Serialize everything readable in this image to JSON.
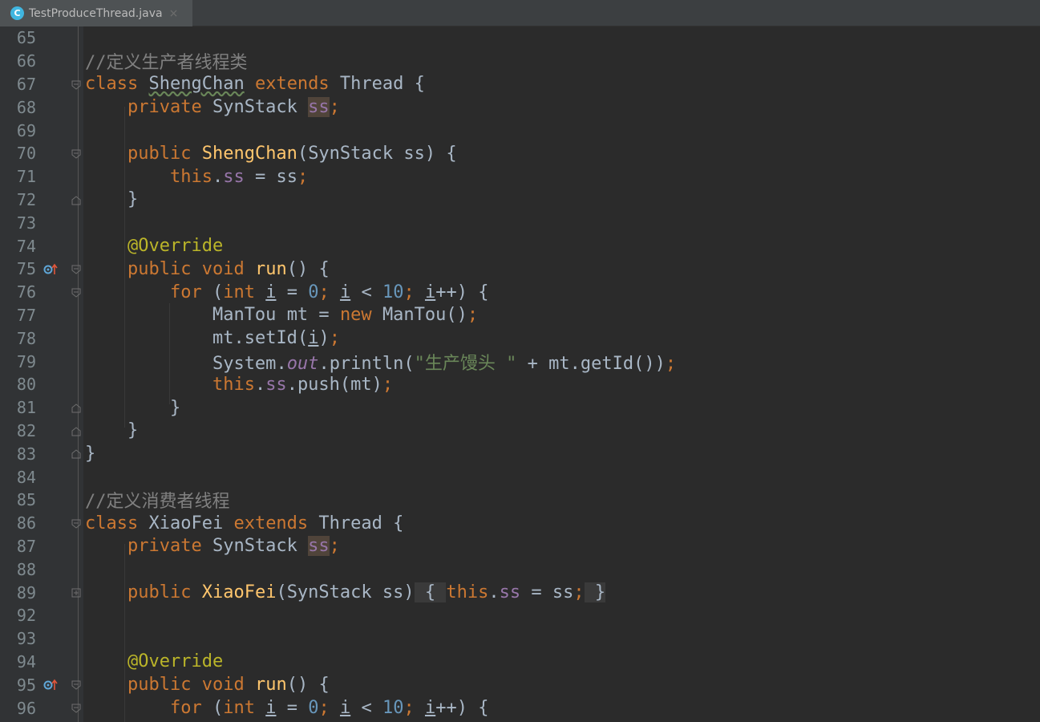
{
  "tab": {
    "icon": "C",
    "title": "TestProduceThread.java",
    "close": "×"
  },
  "lines": {
    "65": "65",
    "66": "66",
    "67": "67",
    "68": "68",
    "69": "69",
    "70": "70",
    "71": "71",
    "72": "72",
    "73": "73",
    "74": "74",
    "75": "75",
    "76": "76",
    "77": "77",
    "78": "78",
    "79": "79",
    "80": "80",
    "81": "81",
    "82": "82",
    "83": "83",
    "84": "84",
    "85": "85",
    "86": "86",
    "87": "87",
    "88": "88",
    "89": "89",
    "92": "92",
    "93": "93",
    "94": "94",
    "95": "95",
    "96": "96"
  },
  "code": {
    "c66": "//定义生产者线程类",
    "c85": "//定义消费者线程",
    "kw_class": "class",
    "kw_extends": "extends",
    "kw_private": "private",
    "kw_public": "public",
    "kw_void": "void",
    "kw_this": "this",
    "kw_for": "for",
    "kw_int": "int",
    "kw_new": "new",
    "t_thread": "Thread",
    "t_synstack": "SynStack",
    "t_mantou": "ManTou",
    "t_system": "System",
    "cls_sheng": "ShengChan",
    "cls_xiao": "XiaoFei",
    "f_ss": "ss",
    "f_out": "out",
    "v_i": "i",
    "v_mt": "mt",
    "n_0": "0",
    "n_10": "10",
    "an_override": "@Override",
    "m_run": "run",
    "m_setid": "setId",
    "m_println": "println",
    "m_getid": "getId",
    "m_push": "push",
    "str_sc": "\"生产馒头 \""
  },
  "colors": {
    "background": "#2b2b2b",
    "keyword": "#cc7832",
    "comment": "#808080",
    "function": "#ffc66d",
    "field": "#9876aa",
    "string": "#6a8759",
    "number": "#6897bb",
    "annotation": "#bbb529",
    "text": "#a9b7c6"
  },
  "icons": {
    "tab": "java-class-icon",
    "gutter": "override-method-icon",
    "fold_open": "fold-collapse-icon",
    "fold_end": "fold-end-icon",
    "fold_plus": "fold-expand-icon"
  }
}
